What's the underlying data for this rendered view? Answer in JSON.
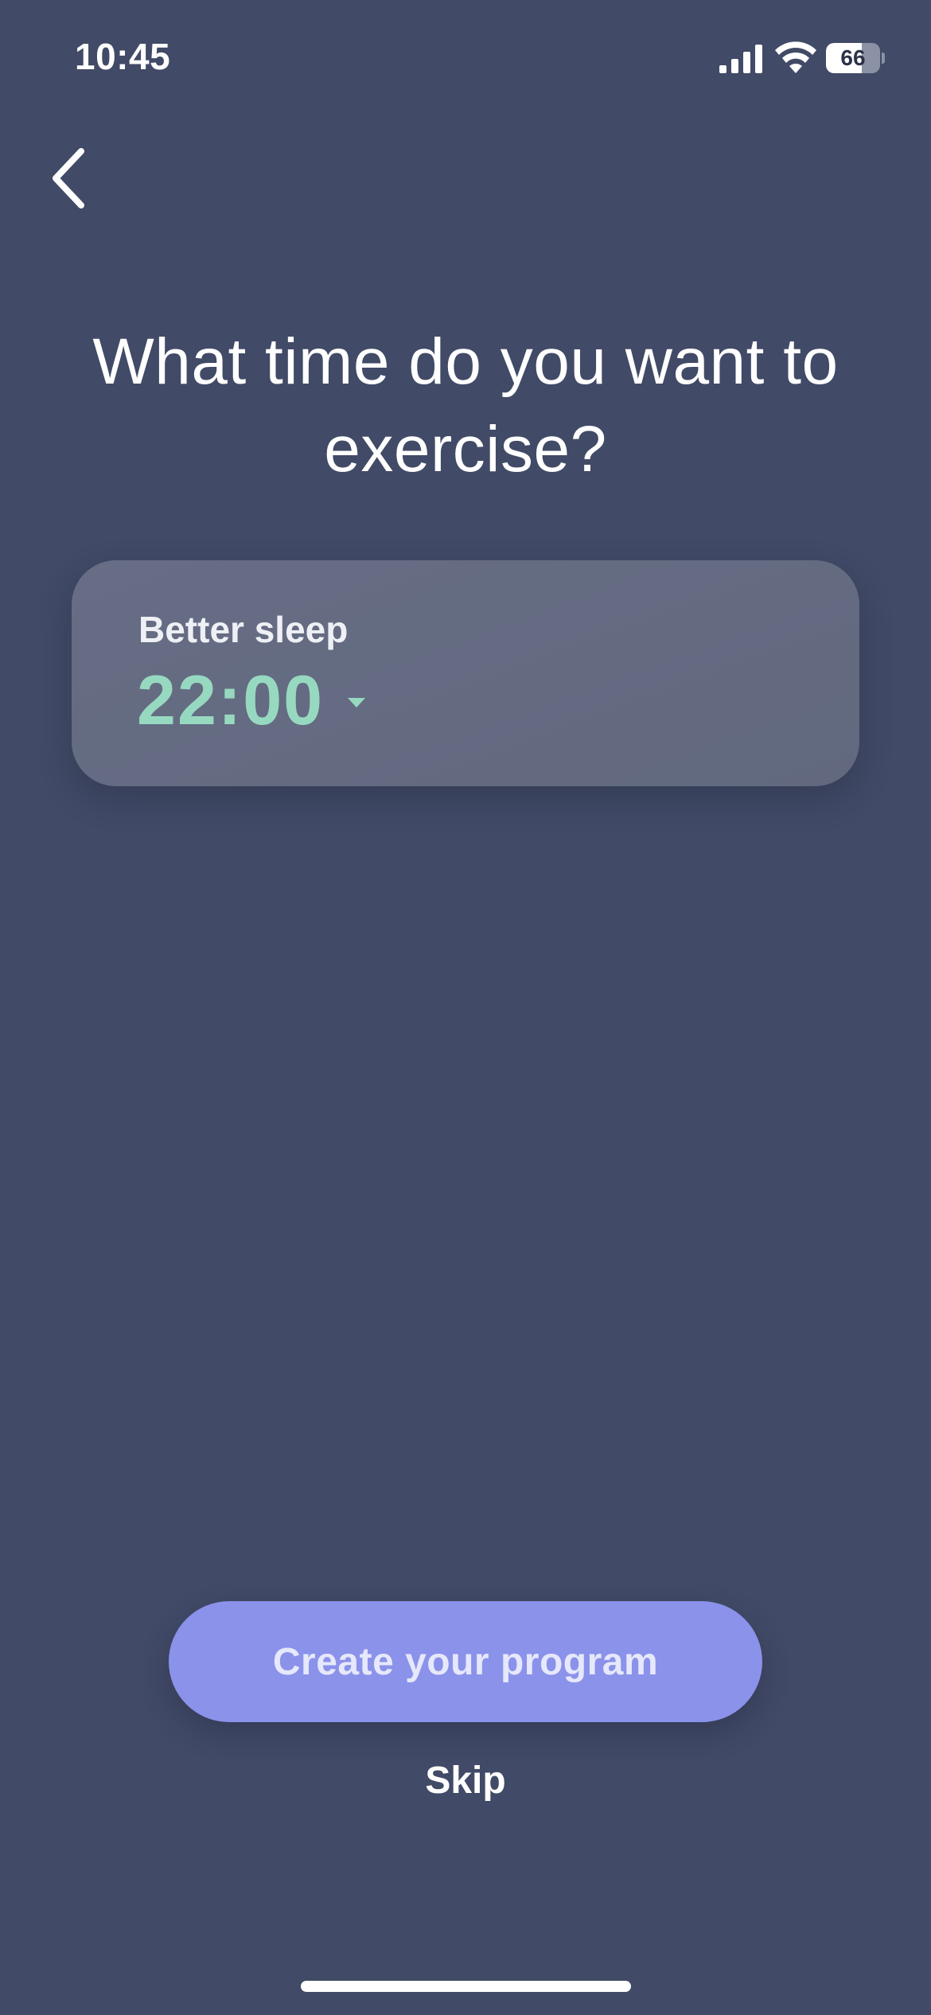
{
  "status_bar": {
    "time": "10:45",
    "battery_level": "66",
    "battery_percent": 66,
    "icons": [
      "signal-icon",
      "wifi-icon",
      "battery-icon"
    ]
  },
  "navigation": {
    "back_icon": "chevron-left-icon"
  },
  "page": {
    "title": "What time do you want to exercise?"
  },
  "goal_card": {
    "label": "Better sleep",
    "time": "22:00",
    "dropdown_icon": "caret-down-icon"
  },
  "actions": {
    "primary_label": "Create your program",
    "skip_label": "Skip"
  },
  "colors": {
    "background": "#414a66",
    "card": "#656c83",
    "accent_time": "#97d9c0",
    "primary_button": "#8b92ea"
  }
}
